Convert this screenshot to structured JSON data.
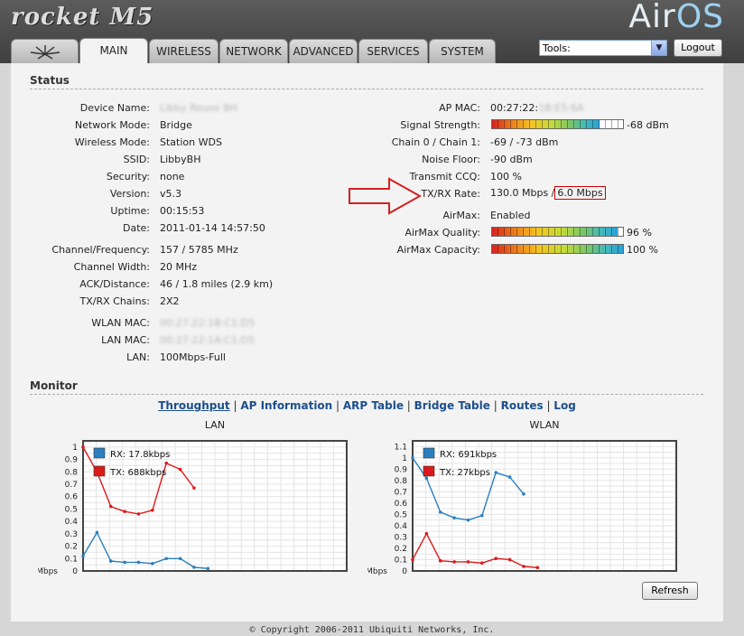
{
  "header": {
    "product_logo": "rocket M5",
    "os_logo_a": "Air",
    "os_logo_b": "OS"
  },
  "tabs": [
    {
      "id": "logo",
      "label": ""
    },
    {
      "id": "main",
      "label": "MAIN"
    },
    {
      "id": "wireless",
      "label": "WIRELESS"
    },
    {
      "id": "network",
      "label": "NETWORK"
    },
    {
      "id": "advanced",
      "label": "ADVANCED"
    },
    {
      "id": "services",
      "label": "SERVICES"
    },
    {
      "id": "system",
      "label": "SYSTEM"
    }
  ],
  "tools": {
    "selected": "Tools:"
  },
  "logout_label": "Logout",
  "status": {
    "title": "Status",
    "left": [
      {
        "label": "Device Name:",
        "value": "Libby Rouse BH",
        "blurred": true
      },
      {
        "label": "Network Mode:",
        "value": "Bridge"
      },
      {
        "label": "Wireless Mode:",
        "value": "Station WDS"
      },
      {
        "label": "SSID:",
        "value": "LibbyBH"
      },
      {
        "label": "Security:",
        "value": "none"
      },
      {
        "label": "Version:",
        "value": "v5.3"
      },
      {
        "label": "Uptime:",
        "value": "00:15:53"
      },
      {
        "label": "Date:",
        "value": "2011-01-14 14:57:50"
      },
      {
        "label": "Channel/Frequency:",
        "value": "157 / 5785 MHz"
      },
      {
        "label": "Channel Width:",
        "value": "20 MHz"
      },
      {
        "label": "ACK/Distance:",
        "value": "46 / 1.8 miles (2.9 km)"
      },
      {
        "label": "TX/RX Chains:",
        "value": "2X2"
      },
      {
        "label": "WLAN MAC:",
        "value": "00:27:22:1B:C1:D5",
        "blurred": true
      },
      {
        "label": "LAN MAC:",
        "value": "00:27:22:1A:C1:D5",
        "blurred": true
      },
      {
        "label": "LAN:",
        "value": "100Mbps-Full"
      }
    ],
    "right": {
      "ap_mac_label": "AP MAC:",
      "ap_mac_value": "00:27:22:",
      "ap_mac_hidden": "1B:E5:6A",
      "signal_label": "Signal Strength:",
      "signal_value": "-68 dBm",
      "signal_level": 0.82,
      "chain_label": "Chain 0 / Chain 1:",
      "chain_value": "-69 / -73 dBm",
      "noise_label": "Noise Floor:",
      "noise_value": "-90 dBm",
      "ccq_label": "Transmit CCQ:",
      "ccq_value": "100 %",
      "rate_label": "TX/RX Rate:",
      "rate_tx": "130.0 Mbps /",
      "rate_rx": "6.0 Mbps",
      "airmax_label": "AirMax:",
      "airmax_value": "Enabled",
      "amq_label": "AirMax Quality:",
      "amq_value": "96 %",
      "amq_level": 0.96,
      "amc_label": "AirMax Capacity:",
      "amc_value": "100 %",
      "amc_level": 1.0
    }
  },
  "monitor": {
    "title": "Monitor",
    "links": [
      "Throughput",
      "AP Information",
      "ARP Table",
      "Bridge Table",
      "Routes",
      "Log"
    ]
  },
  "colors": {
    "rx": "#2a7fc0",
    "tx": "#dd1a1a"
  },
  "chart_data": [
    {
      "type": "line",
      "title": "LAN",
      "ylabel": "Mbps",
      "yticks": [
        "0",
        "0.1",
        "0.2",
        "0.3",
        "0.4",
        "0.5",
        "0.6",
        "0.7",
        "0.8",
        "0.9",
        "1"
      ],
      "ylim": [
        0,
        1.05
      ],
      "grid": true,
      "legend": "top-left",
      "series": [
        {
          "name": "RX: 17.8kbps",
          "values": [
            0.12,
            0.31,
            0.08,
            0.07,
            0.07,
            0.06,
            0.1,
            0.1,
            0.03,
            0.02
          ]
        },
        {
          "name": "TX: 688kbps",
          "values": [
            1.0,
            0.8,
            0.52,
            0.48,
            0.46,
            0.49,
            0.87,
            0.82,
            0.67
          ]
        }
      ]
    },
    {
      "type": "line",
      "title": "WLAN",
      "ylabel": "Mbps",
      "yticks": [
        "0",
        "0.1",
        "0.2",
        "0.3",
        "0.4",
        "0.5",
        "0.6",
        "0.7",
        "0.8",
        "0.9",
        "1",
        "1.1"
      ],
      "ylim": [
        0,
        1.15
      ],
      "grid": true,
      "legend": "top-left",
      "series": [
        {
          "name": "RX: 691kbps",
          "values": [
            1.0,
            0.82,
            0.52,
            0.47,
            0.45,
            0.49,
            0.87,
            0.83,
            0.68
          ]
        },
        {
          "name": "TX: 27kbps",
          "values": [
            0.1,
            0.33,
            0.09,
            0.08,
            0.08,
            0.07,
            0.11,
            0.1,
            0.04,
            0.03
          ]
        }
      ]
    }
  ],
  "refresh_label": "Refresh",
  "footer": "© Copyright 2006-2011 Ubiquiti Networks, Inc."
}
